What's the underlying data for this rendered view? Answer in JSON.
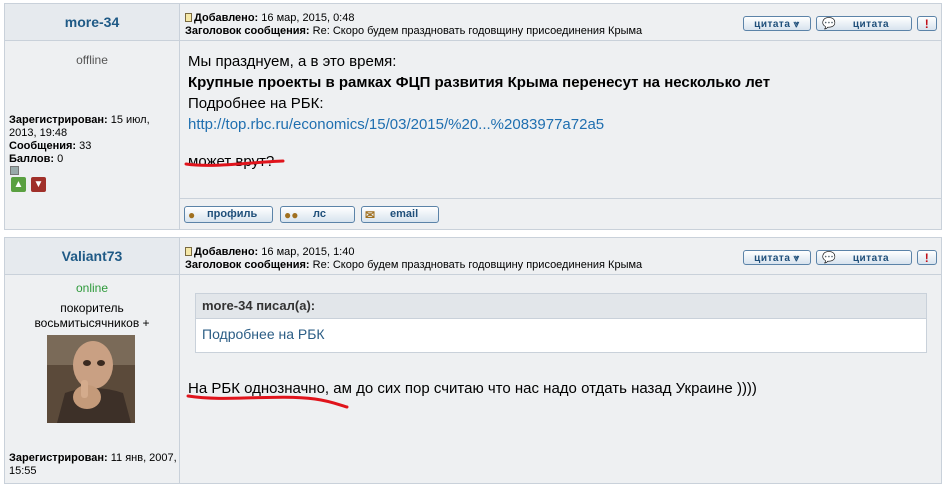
{
  "posts": [
    {
      "author": "more-34",
      "status": "offline",
      "rank": "",
      "stats": {
        "reg_label": "Зарегистрирован:",
        "reg_value": "15 июл, 2013, 19:48",
        "msgs_label": "Сообщения:",
        "msgs_value": "33",
        "points_label": "Баллов:",
        "points_value": "0"
      },
      "header": {
        "added_label": "Добавлено:",
        "added_value": "16 мар, 2015, 0:48",
        "subject_label": "Заголовок сообщения:",
        "subject_value": "Re: Скоро будем праздновать годовщину присоединения Крыма"
      },
      "buttons": {
        "quote": "цитата ⩔",
        "multiquote": "цитата",
        "report": "!"
      },
      "body": {
        "line1": "Мы празднуем, а в это время:",
        "line2": "Крупные проекты в рамках ФЦП развития Крыма перенесут на несколько лет",
        "line3": "Подробнее на РБК:",
        "link": "http://top.rbc.ru/economics/15/03/2015/%20...%2083977a72a5",
        "line5": "может врут?"
      },
      "footer": {
        "profile": "профиль",
        "pm": "лс",
        "email": "email"
      }
    },
    {
      "author": "Valiant73",
      "status": "online",
      "rank": "покоритель восьмитысячников +",
      "stats": {
        "reg_label": "Зарегистрирован:",
        "reg_value": "11 янв, 2007, 15:55"
      },
      "header": {
        "added_label": "Добавлено:",
        "added_value": "16 мар, 2015, 1:40",
        "subject_label": "Заголовок сообщения:",
        "subject_value": "Re: Скоро будем праздновать годовщину присоединения Крыма"
      },
      "buttons": {
        "quote": "цитата ⩔",
        "multiquote": "цитата",
        "report": "!"
      },
      "quote": {
        "author": "more-34 писал(а):",
        "text": "Подробнее на РБК"
      },
      "body": {
        "line1": "На РБК однозначно, ам до сих пор считаю что нас надо отдать назад Украине ))))"
      }
    }
  ],
  "colors": {
    "accent": "#1f5a86",
    "online": "#2e9a3b",
    "underline": "#e0141c"
  }
}
